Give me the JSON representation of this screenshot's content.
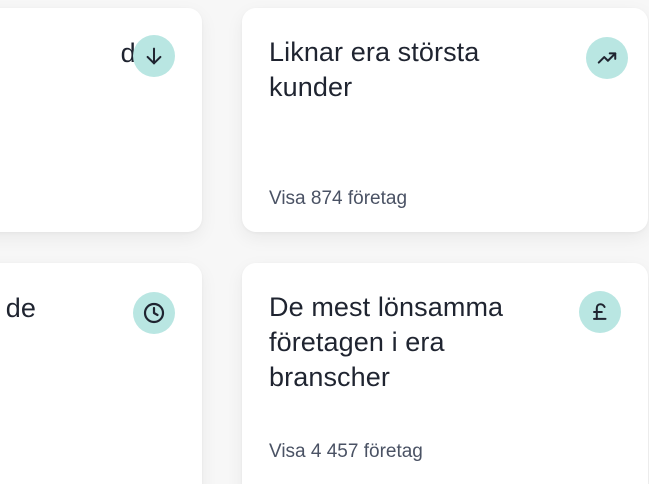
{
  "cards": [
    {
      "title_fragment": "der",
      "icon": "arrow-down-icon"
    },
    {
      "title": "Liknar era största kunder",
      "link": "Visa 874 företag",
      "icon": "trend-up-icon"
    },
    {
      "title_fragment": "de",
      "icon": "clock-icon"
    },
    {
      "title": "De mest lönsamma företagen i era branscher",
      "link": "Visa 4 457 företag",
      "icon": "pound-icon"
    }
  ],
  "colors": {
    "badge": "#b9e6e2",
    "icon_stroke": "#1f2430",
    "title": "#1f2430",
    "link": "#4a5264"
  }
}
